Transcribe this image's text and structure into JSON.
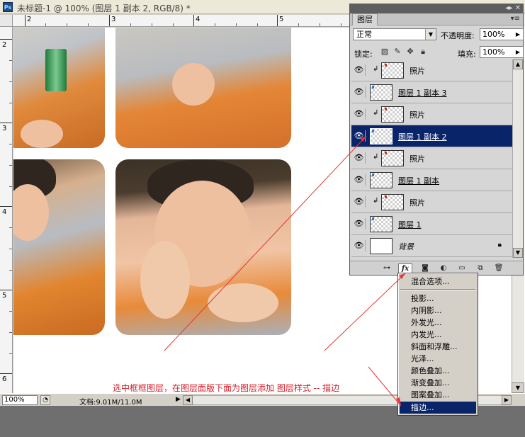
{
  "document": {
    "title": "未标题-1 @ 100% (图层 1 副本 2, RGB/8) *",
    "app_icon": "Ps",
    "ruler_h": [
      "2",
      "3",
      "4",
      "5"
    ],
    "ruler_v": [
      "2",
      "3",
      "4",
      "5",
      "6"
    ],
    "annotation": "选中框框图层，在图层面版下面为图层添加 图层样式 -- 描边"
  },
  "status": {
    "zoom": "100%",
    "doc_info": "文档:9.01M/11.0M"
  },
  "layers_panel": {
    "tab": "图层",
    "blend_mode": "正常",
    "opacity_label": "不透明度:",
    "opacity": "100%",
    "lock_label": "锁定:",
    "fill_label": "填充:",
    "fill": "100%",
    "layers": [
      {
        "name": "照片",
        "clipped": true
      },
      {
        "name": "图层 1 副本 3",
        "clipped": false
      },
      {
        "name": "照片",
        "clipped": true
      },
      {
        "name": "图层 1 副本 2",
        "clipped": false,
        "selected": true
      },
      {
        "name": "照片",
        "clipped": true
      },
      {
        "name": "图层 1 副本",
        "clipped": false
      },
      {
        "name": "照片",
        "clipped": true
      },
      {
        "name": "图层 1",
        "clipped": false
      },
      {
        "name": "背景",
        "clipped": false,
        "locked": true
      }
    ],
    "footer_fx": "fx"
  },
  "style_menu": {
    "items": [
      "混合选项...",
      "投影...",
      "内阴影...",
      "外发光...",
      "内发光...",
      "斜面和浮雕...",
      "光泽...",
      "颜色叠加...",
      "渐变叠加...",
      "图案叠加...",
      "描边..."
    ],
    "highlighted": "描边..."
  },
  "colors": {
    "selection": "#0a246a",
    "annotation": "#d4202a"
  }
}
